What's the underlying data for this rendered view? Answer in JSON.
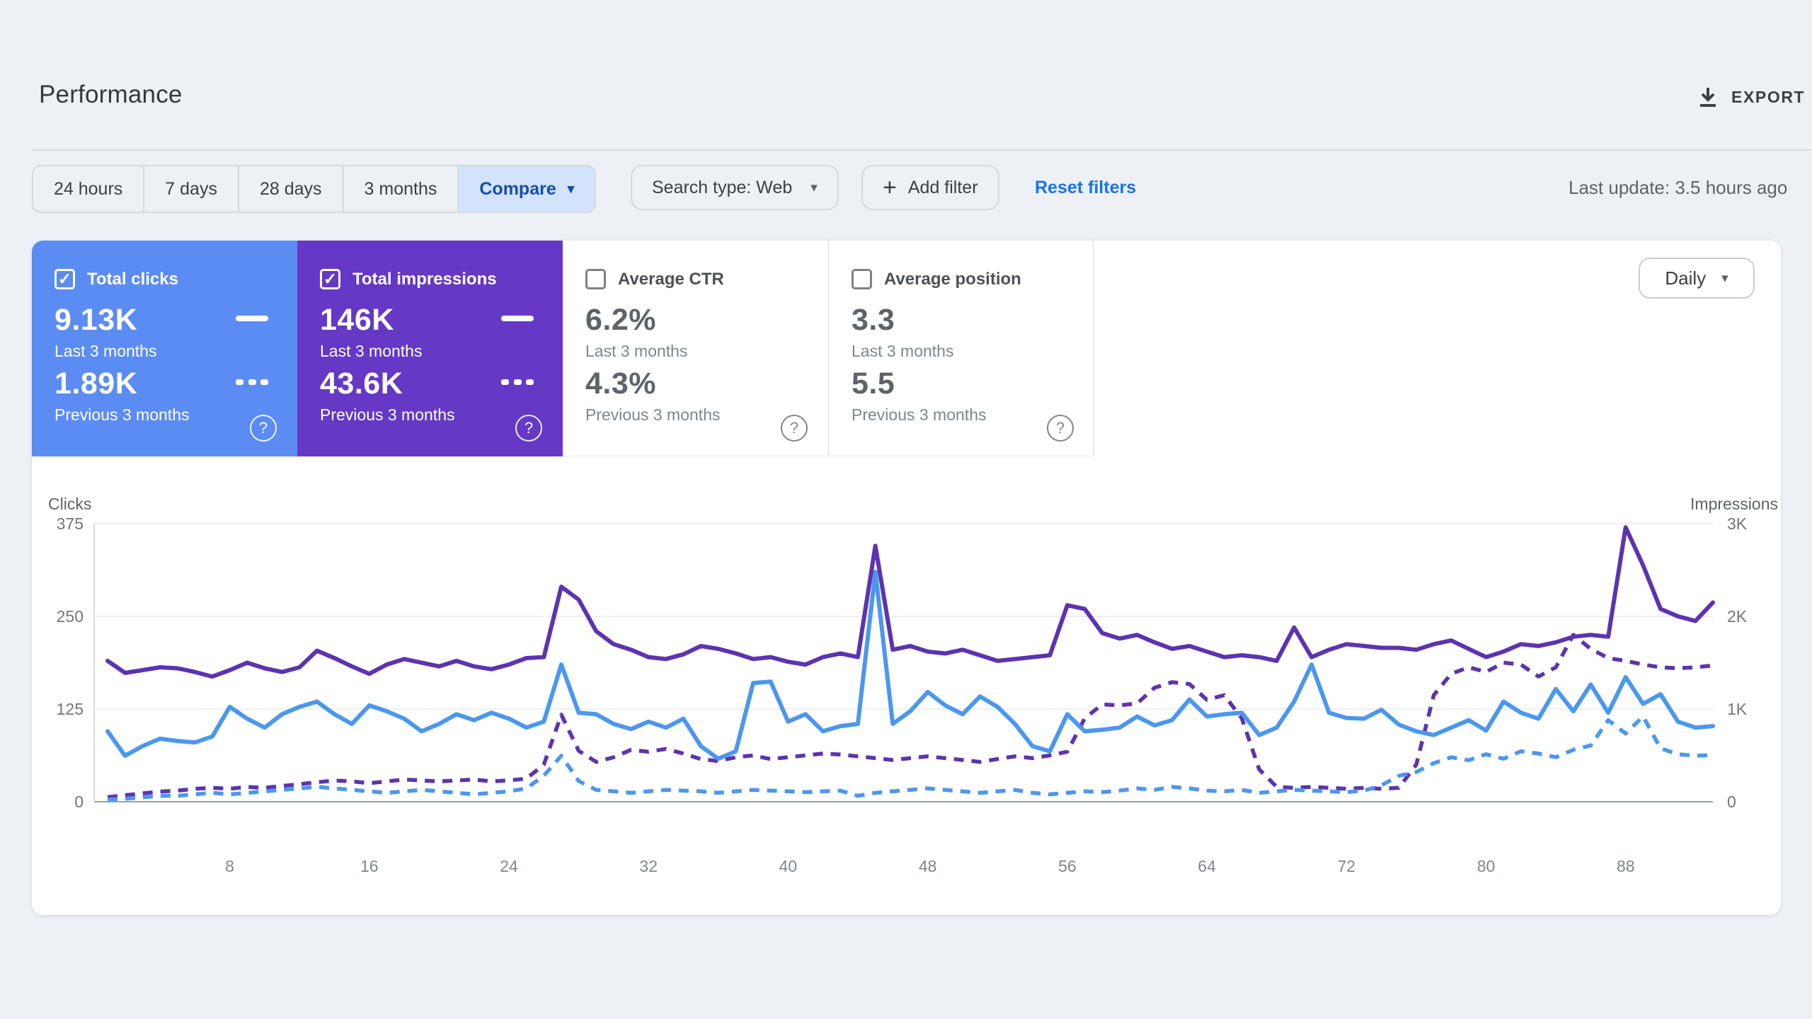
{
  "header": {
    "title": "Performance",
    "export_label": "EXPORT",
    "last_update": "Last update: 3.5 hours ago"
  },
  "glyphs": {
    "caret_down": "▾",
    "plus": "+",
    "check": "✓",
    "question": "?"
  },
  "filters": {
    "date_tabs": [
      {
        "label": "24 hours",
        "selected": false
      },
      {
        "label": "7 days",
        "selected": false
      },
      {
        "label": "28 days",
        "selected": false
      },
      {
        "label": "3 months",
        "selected": false
      },
      {
        "label": "Compare",
        "selected": true
      }
    ],
    "search_type": "Search type: Web",
    "add_filter": "Add filter",
    "reset_filters": "Reset filters"
  },
  "metric_cards": [
    {
      "title": "Total clicks",
      "checked": true,
      "bg": "#5b8cf3",
      "value_primary": "9.13K",
      "label_primary": "Last 3 months",
      "value_secondary": "1.89K",
      "label_secondary": "Previous 3 months"
    },
    {
      "title": "Total impressions",
      "checked": true,
      "bg": "#6538c5",
      "value_primary": "146K",
      "label_primary": "Last 3 months",
      "value_secondary": "43.6K",
      "label_secondary": "Previous 3 months"
    },
    {
      "title": "Average CTR",
      "checked": false,
      "value_primary": "6.2%",
      "label_primary": "Last 3 months",
      "value_secondary": "4.3%",
      "label_secondary": "Previous 3 months"
    },
    {
      "title": "Average position",
      "checked": false,
      "value_primary": "3.3",
      "label_primary": "Last 3 months",
      "value_secondary": "5.5",
      "label_secondary": "Previous 3 months"
    }
  ],
  "granularity": {
    "label": "Daily"
  },
  "chart_data": {
    "type": "line",
    "x_ticks": [
      8,
      16,
      24,
      32,
      40,
      48,
      56,
      64,
      72,
      80,
      88
    ],
    "left_axis": {
      "title": "Clicks",
      "ticks": [
        375,
        250,
        125,
        0
      ],
      "max": 375
    },
    "right_axis": {
      "title": "Impressions",
      "ticks": [
        "3K",
        "2K",
        "1K",
        "0"
      ],
      "max": 3000
    },
    "colors": {
      "clicks": "#4b97f0",
      "impressions": "#5c33b0"
    },
    "series": [
      {
        "name": "Clicks - Last 3 months",
        "style": "solid",
        "color": "#4b97f0",
        "axis": "left",
        "values": [
          95,
          62,
          75,
          85,
          82,
          80,
          88,
          128,
          112,
          100,
          118,
          128,
          135,
          118,
          105,
          130,
          122,
          112,
          95,
          105,
          118,
          110,
          120,
          112,
          100,
          108,
          185,
          120,
          118,
          105,
          98,
          108,
          100,
          112,
          75,
          58,
          68,
          160,
          162,
          108,
          118,
          95,
          102,
          105,
          310,
          105,
          122,
          148,
          130,
          118,
          142,
          128,
          105,
          75,
          68,
          118,
          95,
          97,
          100,
          115,
          103,
          110,
          138,
          115,
          118,
          120,
          90,
          100,
          135,
          185,
          120,
          113,
          112,
          124,
          104,
          95,
          90,
          100,
          110,
          96,
          135,
          120,
          112,
          152,
          122,
          158,
          120,
          168,
          132,
          145,
          108,
          100,
          102
        ]
      },
      {
        "name": "Clicks - Previous 3 months",
        "style": "dashed",
        "color": "#4b97f0",
        "axis": "left",
        "values": [
          3,
          4,
          6,
          8,
          8,
          10,
          12,
          10,
          12,
          14,
          16,
          18,
          20,
          18,
          16,
          14,
          12,
          14,
          16,
          14,
          12,
          10,
          12,
          14,
          18,
          35,
          62,
          28,
          16,
          14,
          12,
          14,
          16,
          15,
          14,
          12,
          14,
          16,
          15,
          14,
          13,
          14,
          15,
          8,
          12,
          14,
          16,
          18,
          16,
          14,
          12,
          14,
          16,
          12,
          10,
          12,
          14,
          13,
          15,
          18,
          16,
          20,
          18,
          15,
          14,
          16,
          12,
          14,
          16,
          15,
          14,
          13,
          15,
          22,
          35,
          40,
          52,
          60,
          56,
          64,
          58,
          68,
          65,
          60,
          70,
          76,
          110,
          92,
          115,
          72,
          64,
          62,
          63
        ]
      },
      {
        "name": "Impressions - Last 3 months",
        "style": "solid",
        "color": "#5c33b0",
        "axis": "right",
        "values": [
          1520,
          1390,
          1420,
          1450,
          1440,
          1400,
          1350,
          1420,
          1500,
          1440,
          1400,
          1450,
          1630,
          1550,
          1460,
          1380,
          1480,
          1540,
          1500,
          1460,
          1520,
          1460,
          1430,
          1480,
          1550,
          1560,
          2320,
          2180,
          1840,
          1700,
          1640,
          1560,
          1540,
          1590,
          1680,
          1650,
          1600,
          1540,
          1560,
          1510,
          1480,
          1560,
          1600,
          1560,
          2760,
          1640,
          1680,
          1620,
          1600,
          1640,
          1580,
          1520,
          1540,
          1560,
          1580,
          2120,
          2080,
          1820,
          1760,
          1800,
          1720,
          1650,
          1680,
          1620,
          1560,
          1580,
          1560,
          1520,
          1880,
          1560,
          1640,
          1700,
          1680,
          1660,
          1660,
          1640,
          1700,
          1740,
          1650,
          1560,
          1620,
          1700,
          1680,
          1720,
          1780,
          1800,
          1780,
          2960,
          2550,
          2080,
          2000,
          1950,
          2150
        ]
      },
      {
        "name": "Impressions - Previous 3 months",
        "style": "dashed",
        "color": "#5c33b0",
        "axis": "right",
        "values": [
          50,
          70,
          90,
          110,
          120,
          140,
          150,
          140,
          160,
          150,
          170,
          190,
          210,
          230,
          220,
          200,
          220,
          240,
          230,
          220,
          230,
          240,
          220,
          230,
          250,
          400,
          940,
          550,
          430,
          480,
          560,
          540,
          570,
          520,
          460,
          440,
          480,
          500,
          460,
          480,
          500,
          520,
          510,
          490,
          470,
          450,
          470,
          490,
          470,
          450,
          430,
          460,
          490,
          470,
          500,
          540,
          900,
          1050,
          1040,
          1060,
          1230,
          1290,
          1270,
          1100,
          1150,
          900,
          350,
          160,
          150,
          160,
          150,
          140,
          150,
          140,
          150,
          400,
          1150,
          1380,
          1450,
          1400,
          1500,
          1480,
          1350,
          1450,
          1800,
          1650,
          1550,
          1520,
          1480,
          1450,
          1440,
          1450,
          1470
        ]
      }
    ]
  }
}
